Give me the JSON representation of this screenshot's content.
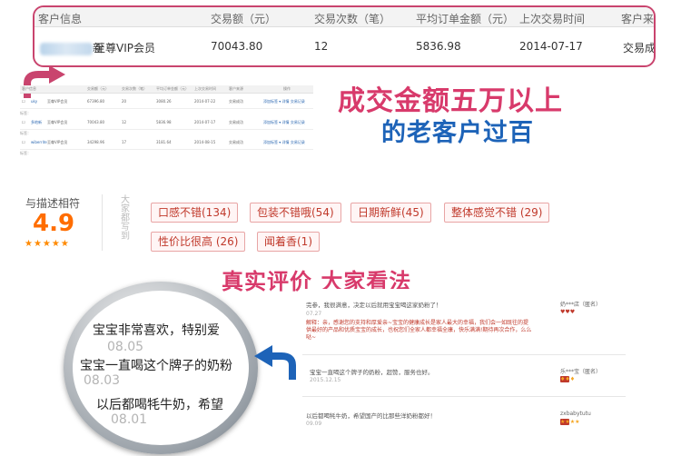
{
  "top_table": {
    "headers": [
      "客户信息",
      "交易额（元）",
      "交易次数（笔）",
      "平均订单金额（元）",
      "上次交易时间",
      "客户来"
    ],
    "row": {
      "name_suffix": "新",
      "level": "至尊VIP会员",
      "amount": "70043.80",
      "count": "12",
      "avg": "5836.98",
      "last_date": "2014-07-17",
      "status": "交易成"
    }
  },
  "mini_table": {
    "headers": [
      "客户信息",
      "交易额（元）",
      "交易次数（笔）",
      "平均订单金额（元）",
      "上次交易时间",
      "客户来源",
      "操作"
    ],
    "rows": [
      {
        "name": "uky",
        "level": "至尊VIP会员",
        "amount": "67396.80",
        "count": "20",
        "avg": "3080.26",
        "date": "2014-07-22",
        "status": "交易成功",
        "actions": "添加标签 ▾  详情  交易记录"
      },
      {
        "name": "多地新",
        "level": "至尊VIP会员",
        "amount": "70043.80",
        "count": "12",
        "avg": "5836.98",
        "date": "2014-07-17",
        "status": "交易成功",
        "actions": "添加标签 ▾  详情  交易记录"
      },
      {
        "name": "wiberrite",
        "level": "至尊VIP会员",
        "amount": "34298.96",
        "count": "17",
        "avg": "3181.64",
        "date": "2014-08-15",
        "status": "交易成功",
        "actions": "添加标签 ▾  详情  交易记录"
      }
    ],
    "sub_label": "标签："
  },
  "headline": {
    "line1": "成交金额五万以上",
    "line2": "的老客户过百"
  },
  "rating": {
    "label": "与描述相符",
    "score": "4.9",
    "stars": "★★★★★"
  },
  "tags_label": "大家都写到",
  "tags": [
    "口感不错(134)",
    "包装不错哦(54)",
    "日期新鲜(45)",
    "整体感觉不错 (29)",
    "性价比很高 (26)",
    "闻着香(1)"
  ],
  "headline3": "真实评价 大家看法",
  "magnifier": {
    "lines": [
      "宝宝非常喜欢，特别爱",
      "宝宝一直喝这个牌子的奶粉",
      "以后都喝牦牛奶，希望"
    ],
    "dates": [
      "08.05",
      "08.03",
      "08.01"
    ]
  },
  "reviews": [
    {
      "text": "完参，我很满意，决定以后就用宝宝喝这家奶粉了！",
      "date": "07.27",
      "user": "奶***店（匿名）",
      "reply": "解释：亲，感谢您的支持和厚爱亲~宝宝的健康成长是家人最大的幸福，我们会一如既往的提供最好的产品和优质宝宝的成长，也祝您们全家人都幸福全康，快乐满满!期待再次合作，么么哒~"
    },
    {
      "text": "宝宝一直喝这个牌子的奶粉，超赞，服务也好。",
      "date": "2015.12.15",
      "user": "乐***宝（匿名）"
    },
    {
      "text": "以后都喝牦牛奶，希望国产的比那些洋奶粉都好！",
      "date": "09.09",
      "user": "zxbabytutu"
    }
  ],
  "colors": {
    "accent_pink": "#d83a6b",
    "accent_blue": "#1d63b8",
    "score_orange": "#ff6d00",
    "tag_red": "#c0392b"
  }
}
